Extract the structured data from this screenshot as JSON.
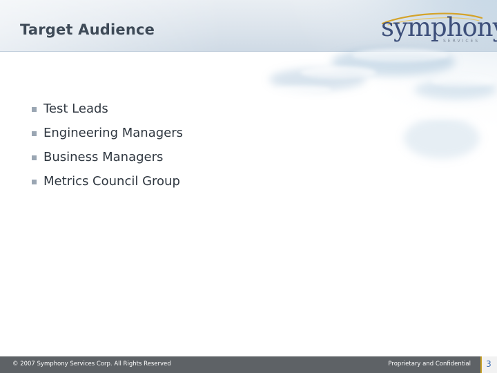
{
  "slide": {
    "title": "Target Audience",
    "bullets": [
      "Test Leads",
      "Engineering Managers",
      "Business Managers",
      "Metrics Council Group"
    ]
  },
  "logo": {
    "wordmark": "symphony",
    "tagline": "SERVICES"
  },
  "footer": {
    "copyright": "© 2007 Symphony Services Corp. All Rights Reserved",
    "confidential": "Proprietary and Confidential",
    "page_number": "3"
  },
  "colors": {
    "title_text": "#3e4a57",
    "bullet_marker": "#9aa6b3",
    "footer_bar": "#5e6266",
    "page_number": "#3d6fb6",
    "logo_text": "#3d4f7a",
    "logo_swoosh": "#d4a32a"
  }
}
